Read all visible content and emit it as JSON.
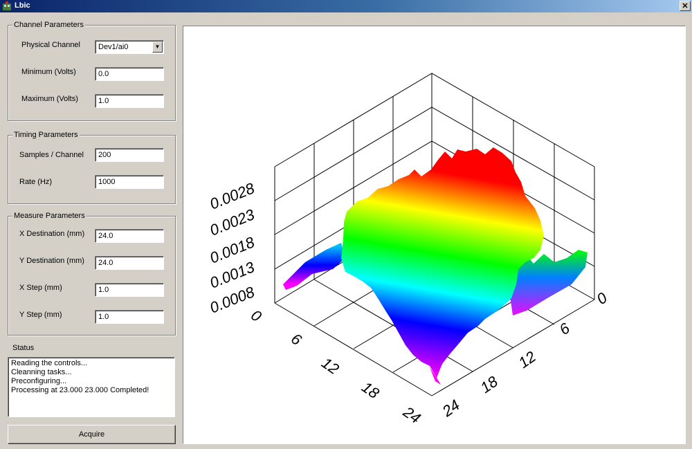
{
  "window": {
    "title": "Lbic",
    "close_glyph": "✕"
  },
  "channel_parameters": {
    "legend": "Channel Parameters",
    "physical_channel_label": "Physical Channel",
    "physical_channel_value": "Dev1/ai0",
    "minimum_label": "Minimum (Volts)",
    "minimum_value": "0.0",
    "maximum_label": "Maximum (Volts)",
    "maximum_value": "1.0"
  },
  "timing_parameters": {
    "legend": "Timing Parameters",
    "samples_label": "Samples / Channel",
    "samples_value": "200",
    "rate_label": "Rate (Hz)",
    "rate_value": "1000"
  },
  "measure_parameters": {
    "legend": "Measure Parameters",
    "x_dest_label": "X Destination (mm)",
    "x_dest_value": "24.0",
    "y_dest_label": "Y Destination (mm)",
    "y_dest_value": "24.0",
    "x_step_label": "X Step (mm)",
    "x_step_value": "1.0",
    "y_step_label": "Y Step (mm)",
    "y_step_value": "1.0"
  },
  "status": {
    "label": "Status",
    "lines": [
      "Reading the controls...",
      "Cleanning tasks...",
      "Preconfiguring...",
      "Processing at 23.000 23.000 Completed!"
    ]
  },
  "acquire_label": "Acquire",
  "chart_data": {
    "type": "surface",
    "z_ticks": [
      "0.0008",
      "0.0013",
      "0.0018",
      "0.0023",
      "0.0028"
    ],
    "x_ticks": [
      "0",
      "6",
      "12",
      "18",
      "24"
    ],
    "y_ticks": [
      "0",
      "6",
      "12",
      "18",
      "24"
    ],
    "x_range": [
      0,
      24
    ],
    "y_range": [
      0,
      24
    ],
    "colormap": [
      "#ff0000",
      "#ffff00",
      "#00ff00",
      "#00ffff",
      "#0000ff",
      "#ff00ff"
    ]
  }
}
